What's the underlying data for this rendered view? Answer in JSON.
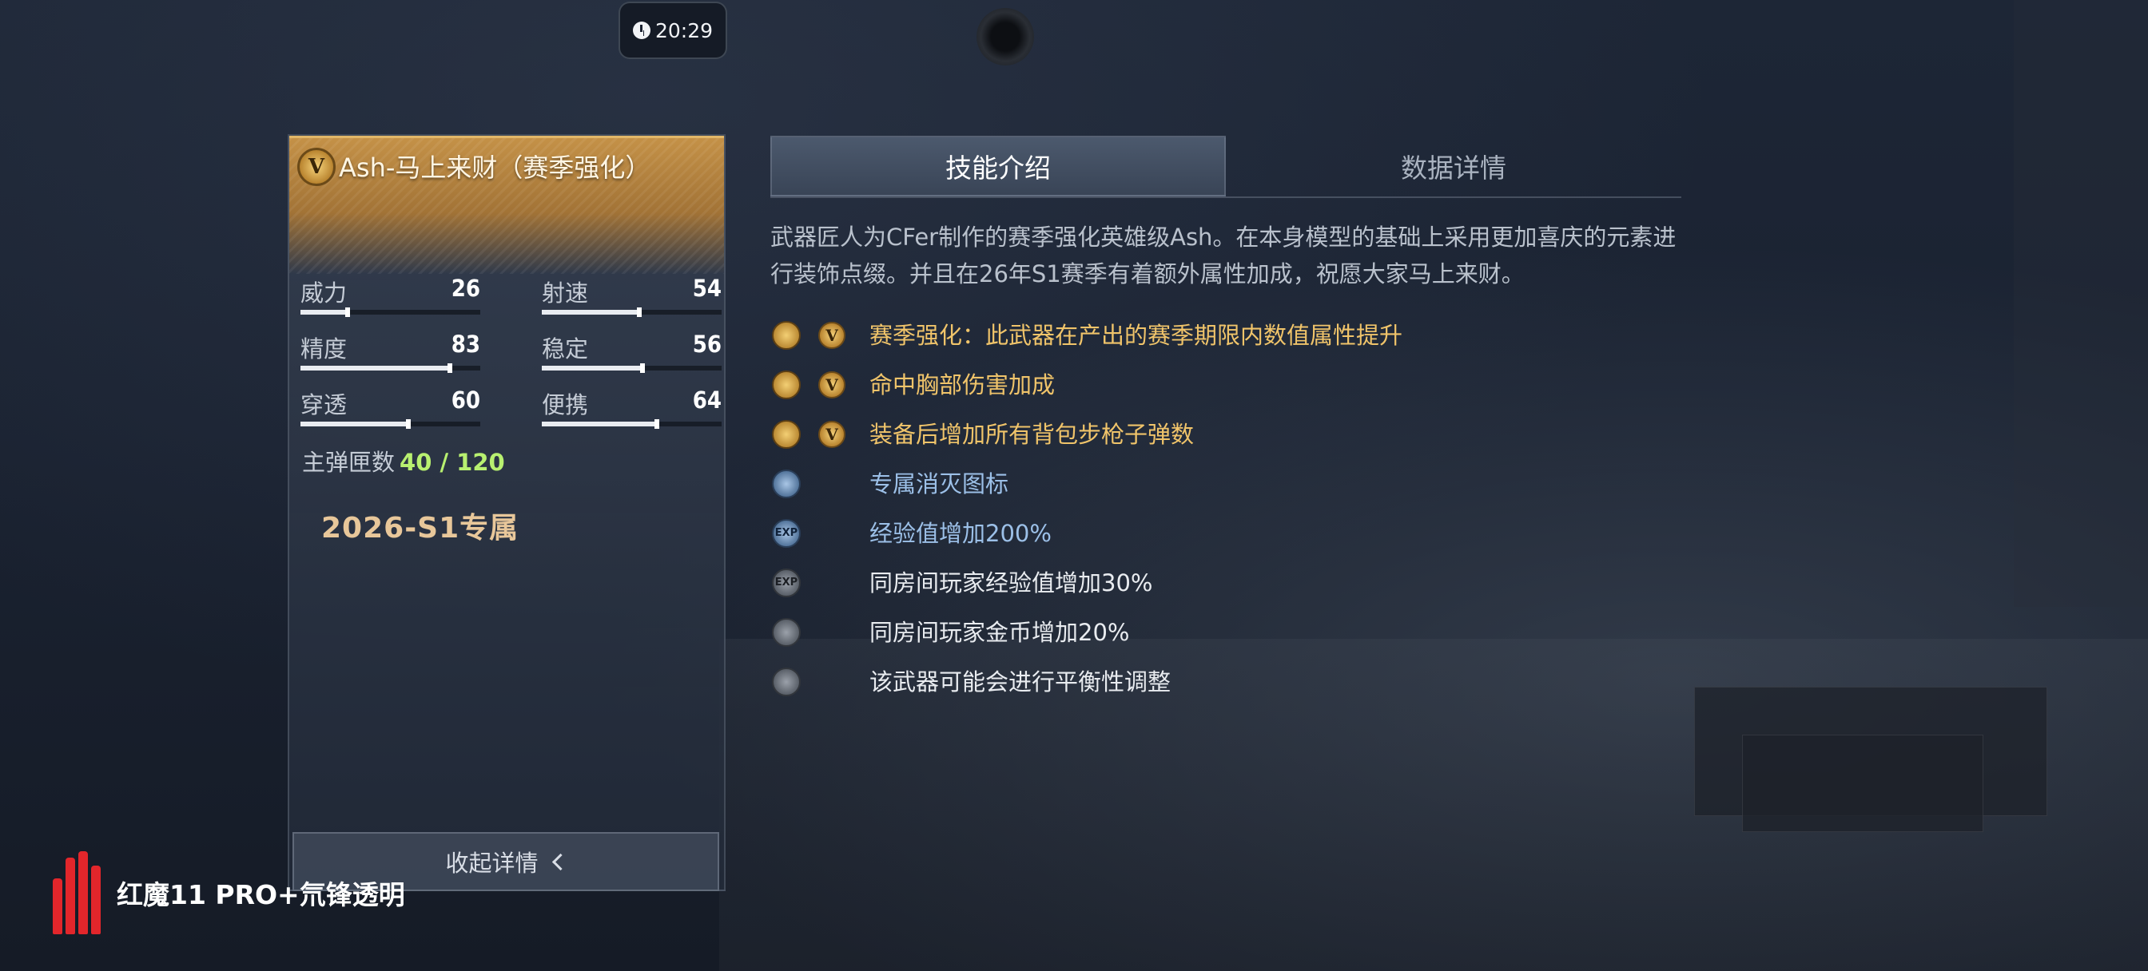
{
  "status": {
    "time": "20:29"
  },
  "weapon": {
    "badge": "V",
    "title": "Ash-马上来财（赛季强化）",
    "stats": [
      {
        "label": "威力",
        "value": 26,
        "level": 0.26
      },
      {
        "label": "射速",
        "value": 54,
        "level": 0.54
      },
      {
        "label": "精度",
        "value": 83,
        "level": 0.83
      },
      {
        "label": "稳定",
        "value": 56,
        "level": 0.56
      },
      {
        "label": "穿透",
        "value": 60,
        "level": 0.6
      },
      {
        "label": "便携",
        "value": 64,
        "level": 0.64
      }
    ],
    "ammo_label": "主弹匣数",
    "ammo_value": "40 / 120",
    "season_tag": "2026-S1专属",
    "collapse_label": "收起详情"
  },
  "tabs": {
    "skills": "技能介绍",
    "details": "数据详情"
  },
  "description": "武器匠人为CFer制作的赛季强化英雄级Ash。在本身模型的基础上采用更加喜庆的元素进行装饰点缀。并且在26年S1赛季有着额外属性加成，祝愿大家马上来财。",
  "features": [
    {
      "text": "赛季强化：此武器在产出的赛季期限内数值属性提升",
      "icon": "season-up-icon",
      "tier": "gold",
      "badge": "V"
    },
    {
      "text": "命中胸部伤害加成",
      "icon": "chest-damage-icon",
      "tier": "gold",
      "badge": "V"
    },
    {
      "text": "装备后增加所有背包步枪子弹数",
      "icon": "ammo-bonus-icon",
      "tier": "gold",
      "badge": "V"
    },
    {
      "text": "专属消灭图标",
      "icon": "kill-mark-icon",
      "tier": "blue",
      "badge": ""
    },
    {
      "text": "经验值增加200%",
      "icon": "exp-icon",
      "tier": "blue",
      "badge": ""
    },
    {
      "text": "同房间玩家经验值增加30%",
      "icon": "room-exp-icon",
      "tier": "grey",
      "badge": ""
    },
    {
      "text": "同房间玩家金币增加20%",
      "icon": "room-gold-icon",
      "tier": "grey",
      "badge": ""
    },
    {
      "text": "该武器可能会进行平衡性调整",
      "icon": "balance-icon",
      "tier": "grey",
      "badge": ""
    }
  ],
  "watermark": "红魔11 PRO+氘锋透明",
  "colors": {
    "gold": "#f0c46a",
    "blue": "#9cc0e8",
    "ammo_green": "#b8f070",
    "card_header": "#c49147"
  }
}
